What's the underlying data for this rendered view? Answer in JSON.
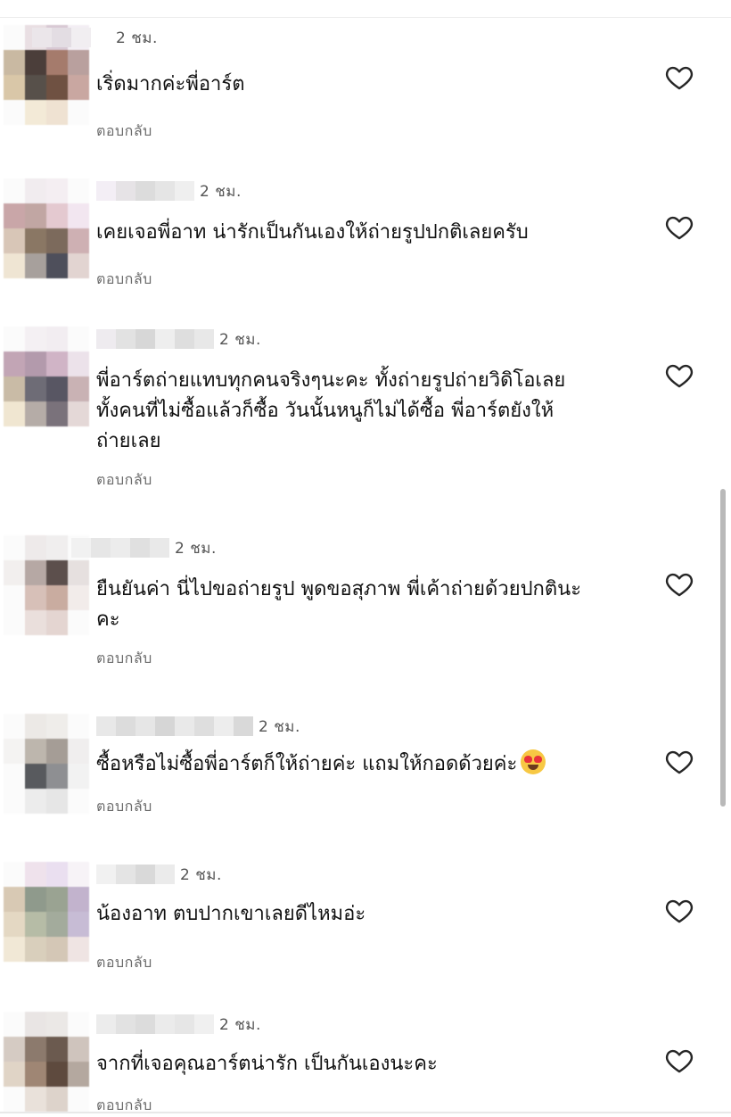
{
  "colors": {
    "background": "#ffffff",
    "text": "#111111",
    "secondary_text": "#6b6b6b",
    "heart_outline": "#262626"
  },
  "icons": {
    "like": "heart-outline-icon",
    "emoji": "smiling-face-with-heart-eyes-icon"
  },
  "comments": [
    {
      "time": "2 ชม.",
      "text": "เริ่ดมากค่ะพี่อาร์ต",
      "reply": "ตอบกลับ"
    },
    {
      "time": "2 ชม.",
      "text": "เคยเจอพี่อาท น่ารักเป็นกันเองให้ถ่ายรูปปกติเลยครับ",
      "reply": "ตอบกลับ"
    },
    {
      "time": "2 ชม.",
      "text": "พี่อาร์ตถ่ายแทบทุกคนจริงๆนะคะ ทั้งถ่ายรูปถ่ายวิดิโอเลย\nทั้งคนที่ไม่ซื้อแล้วก็ซื้อ วันนั้นหนูก็ไม่ได้ซื้อ พี่อาร์ตยังให้\nถ่ายเลย",
      "reply": "ตอบกลับ"
    },
    {
      "time": "2 ชม.",
      "text": "ยืนยันค่า นี่ไปขอถ่ายรูป พูดขอสุภาพ พี่เค้าถ่ายด้วยปกตินะ\nคะ",
      "reply": "ตอบกลับ"
    },
    {
      "time": "2 ชม.",
      "text": "ซื้อหรือไม่ซื้อพี่อาร์ตก็ให้ถ่ายค่ะ แถมให้กอดด้วยค่ะ",
      "reply": "ตอบกลับ"
    },
    {
      "time": "2 ชม.",
      "text": "น้องอาท ตบปากเขาเลยดีไหมอ่ะ",
      "reply": "ตอบกลับ"
    },
    {
      "time": "2 ชม.",
      "text": "จากที่เจอคุณอาร์ตน่ารัก เป็นกันเองนะคะ",
      "reply": "ตอบกลับ"
    }
  ]
}
